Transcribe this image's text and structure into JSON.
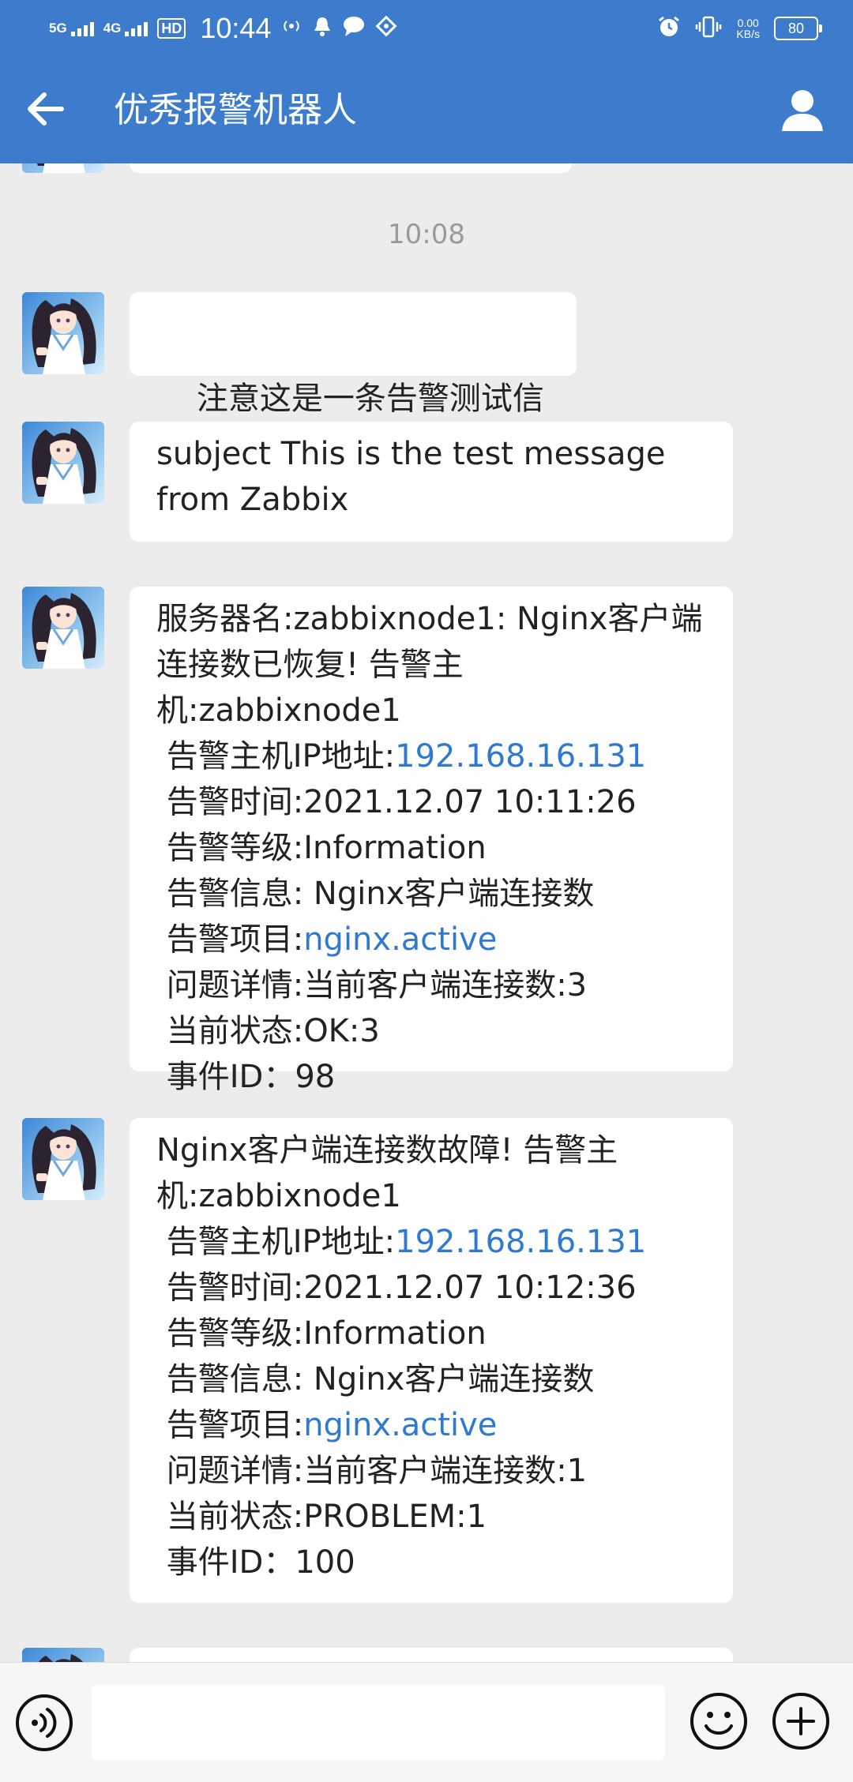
{
  "status_bar": {
    "sig1": "5G",
    "sig2": "4G",
    "hd": "HD",
    "time": "10:44",
    "net_speed_value": "0.00",
    "net_speed_unit": "KB/s",
    "battery": "80"
  },
  "header": {
    "title": "优秀报警机器人"
  },
  "chat": {
    "timestamp": "10:08",
    "messages": [
      {
        "text": "注意这是一条告警测试信息"
      },
      {
        "text": "subject This is the test message\nfrom Zabbix"
      },
      {
        "lines": [
          "服务器名:zabbixnode1: Nginx客户端",
          "连接数已恢复! 告警主机:zabbixnode1",
          " 告警主机IP地址:",
          " 告警时间:2021.12.07 10:11:26",
          " 告警等级:Information",
          " 告警信息: Nginx客户端连接数",
          " 告警项目:",
          " 问题详情:当前客户端连接数:3",
          " 当前状态:OK:3",
          " 事件ID：98"
        ],
        "ip": "192.168.16.131",
        "item": "nginx.active"
      },
      {
        "lines": [
          "Nginx客户端连接数故障! 告警主",
          "机:zabbixnode1",
          " 告警主机IP地址:",
          " 告警时间:2021.12.07 10:12:36",
          " 告警等级:Information",
          " 告警信息: Nginx客户端连接数",
          " 告警项目:",
          " 问题详情:当前客户端连接数:1",
          " 当前状态:PROBLEM:1",
          " 事件ID：100"
        ],
        "ip": "192.168.16.131",
        "item": "nginx.active"
      }
    ]
  },
  "input_bar": {
    "placeholder": ""
  },
  "colors": {
    "header": "#3d7ccd",
    "background": "#ececec",
    "bubble": "#ffffff",
    "link": "#2f79d0"
  },
  "icons": {
    "back": "arrow-left-icon",
    "profile": "person-icon",
    "voice": "voice-icon",
    "emoji": "smile-icon",
    "plus": "plus-icon"
  }
}
